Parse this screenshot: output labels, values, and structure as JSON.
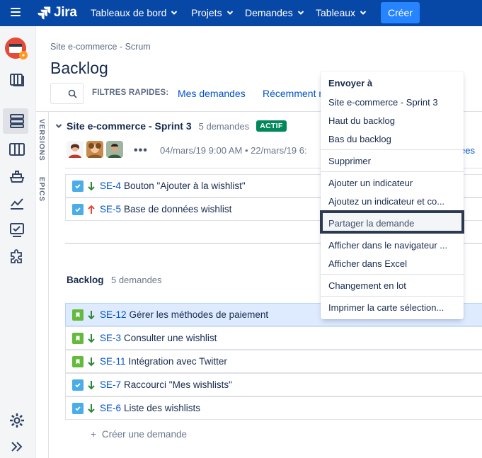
{
  "nav": {
    "brand": "Jira",
    "items": [
      {
        "label": "Tableaux de bord"
      },
      {
        "label": "Projets"
      },
      {
        "label": "Demandes"
      },
      {
        "label": "Tableaux"
      }
    ],
    "create_label": "Créer",
    "accent": "#0747a6"
  },
  "sidebar": {
    "icons": [
      "project-avatar-icon",
      "board-icon",
      "backlog-icon",
      "columns-icon",
      "releases-icon",
      "reports-icon",
      "issues-icon",
      "addons-icon",
      "settings-icon",
      "expand-icon"
    ]
  },
  "vertical_tabs": {
    "versions": "VERSIONS",
    "epics": "EPICS"
  },
  "header": {
    "breadcrumb": "Site e-commerce - Scrum",
    "title": "Backlog",
    "quick_filters_label": "FILTRES RAPIDES:",
    "quick_filters": [
      "Mes demandes",
      "Récemment m"
    ]
  },
  "sprint": {
    "name": "Site e-commerce - Sprint 3",
    "count": "5 demandes",
    "status": "ACTIF",
    "dates": "04/mars/19 9:00 AM • 22/mars/19 6:",
    "right_link": "ées",
    "issues": [
      {
        "key": "SE-4",
        "summary": "Bouton \"Ajouter à la wishlist\"",
        "type": "task",
        "priority": "low"
      },
      {
        "key": "SE-5",
        "summary": "Base de données wishlist",
        "type": "task",
        "priority": "high"
      }
    ]
  },
  "backlog": {
    "title": "Backlog",
    "count": "5 demandes",
    "issues": [
      {
        "key": "SE-12",
        "summary": "Gérer les méthodes de paiement",
        "type": "story",
        "priority": "low"
      },
      {
        "key": "SE-3",
        "summary": "Consulter une wishlist",
        "type": "story",
        "priority": "low"
      },
      {
        "key": "SE-11",
        "summary": "Intégration avec Twitter",
        "type": "story",
        "priority": "low"
      },
      {
        "key": "SE-7",
        "summary": "Raccourci \"Mes wishlists\"",
        "type": "task",
        "priority": "low"
      },
      {
        "key": "SE-6",
        "summary": "Liste des wishlists",
        "type": "task",
        "priority": "low"
      }
    ],
    "create_label": "Créer une demande"
  },
  "context_menu": {
    "heading": "Envoyer à",
    "items": [
      "Site e-commerce - Sprint 3",
      "Haut du backlog",
      "Bas du backlog",
      "Supprimer",
      "Ajouter un indicateur",
      "Ajoutez un indicateur et co...",
      "Partager la demande",
      "Afficher dans le navigateur ...",
      "Afficher dans Excel",
      "Changement en lot",
      "Imprimer la carte sélection..."
    ]
  }
}
